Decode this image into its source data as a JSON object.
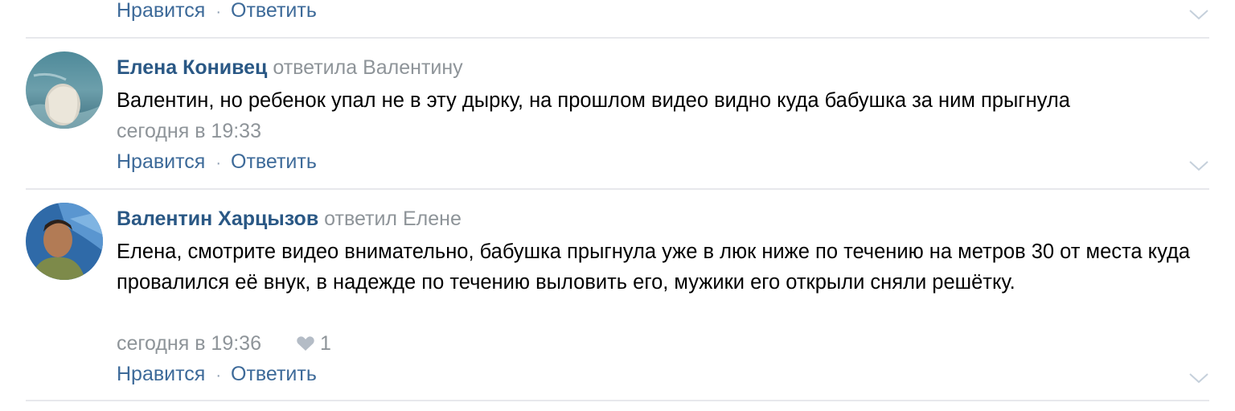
{
  "top_comment": {
    "like_label": "Нравится",
    "separator": "·",
    "reply_label": "Ответить"
  },
  "comments": [
    {
      "author": "Елена Конивец",
      "reply_to": "ответила Валентину",
      "text": "Валентин, но ребенок упал не в эту дырку, на прошлом видео видно куда бабушка за ним прыгнула",
      "time": "сегодня в 19:33",
      "like_label": "Нравится",
      "separator": "·",
      "reply_label": "Ответить"
    },
    {
      "author": "Валентин Харцызов",
      "reply_to": "ответил Елене",
      "text": "Елена, смотрите видео внимательно, бабушка прыгнула уже в люк ниже по течению на метров 30 от места куда провалился её внук, в надежде по течению выловить его, мужики его открыли сняли решётку.",
      "time": "сегодня в 19:36",
      "likes_count": "1",
      "like_label": "Нравится",
      "separator": "·",
      "reply_label": "Ответить"
    }
  ],
  "icons": {
    "heart": "heart-icon",
    "chevron": "chevron-down-icon"
  },
  "colors": {
    "link": "#2a5885",
    "action": "#3d6a99",
    "muted": "#8e9499",
    "divider": "#e7e8ec"
  }
}
